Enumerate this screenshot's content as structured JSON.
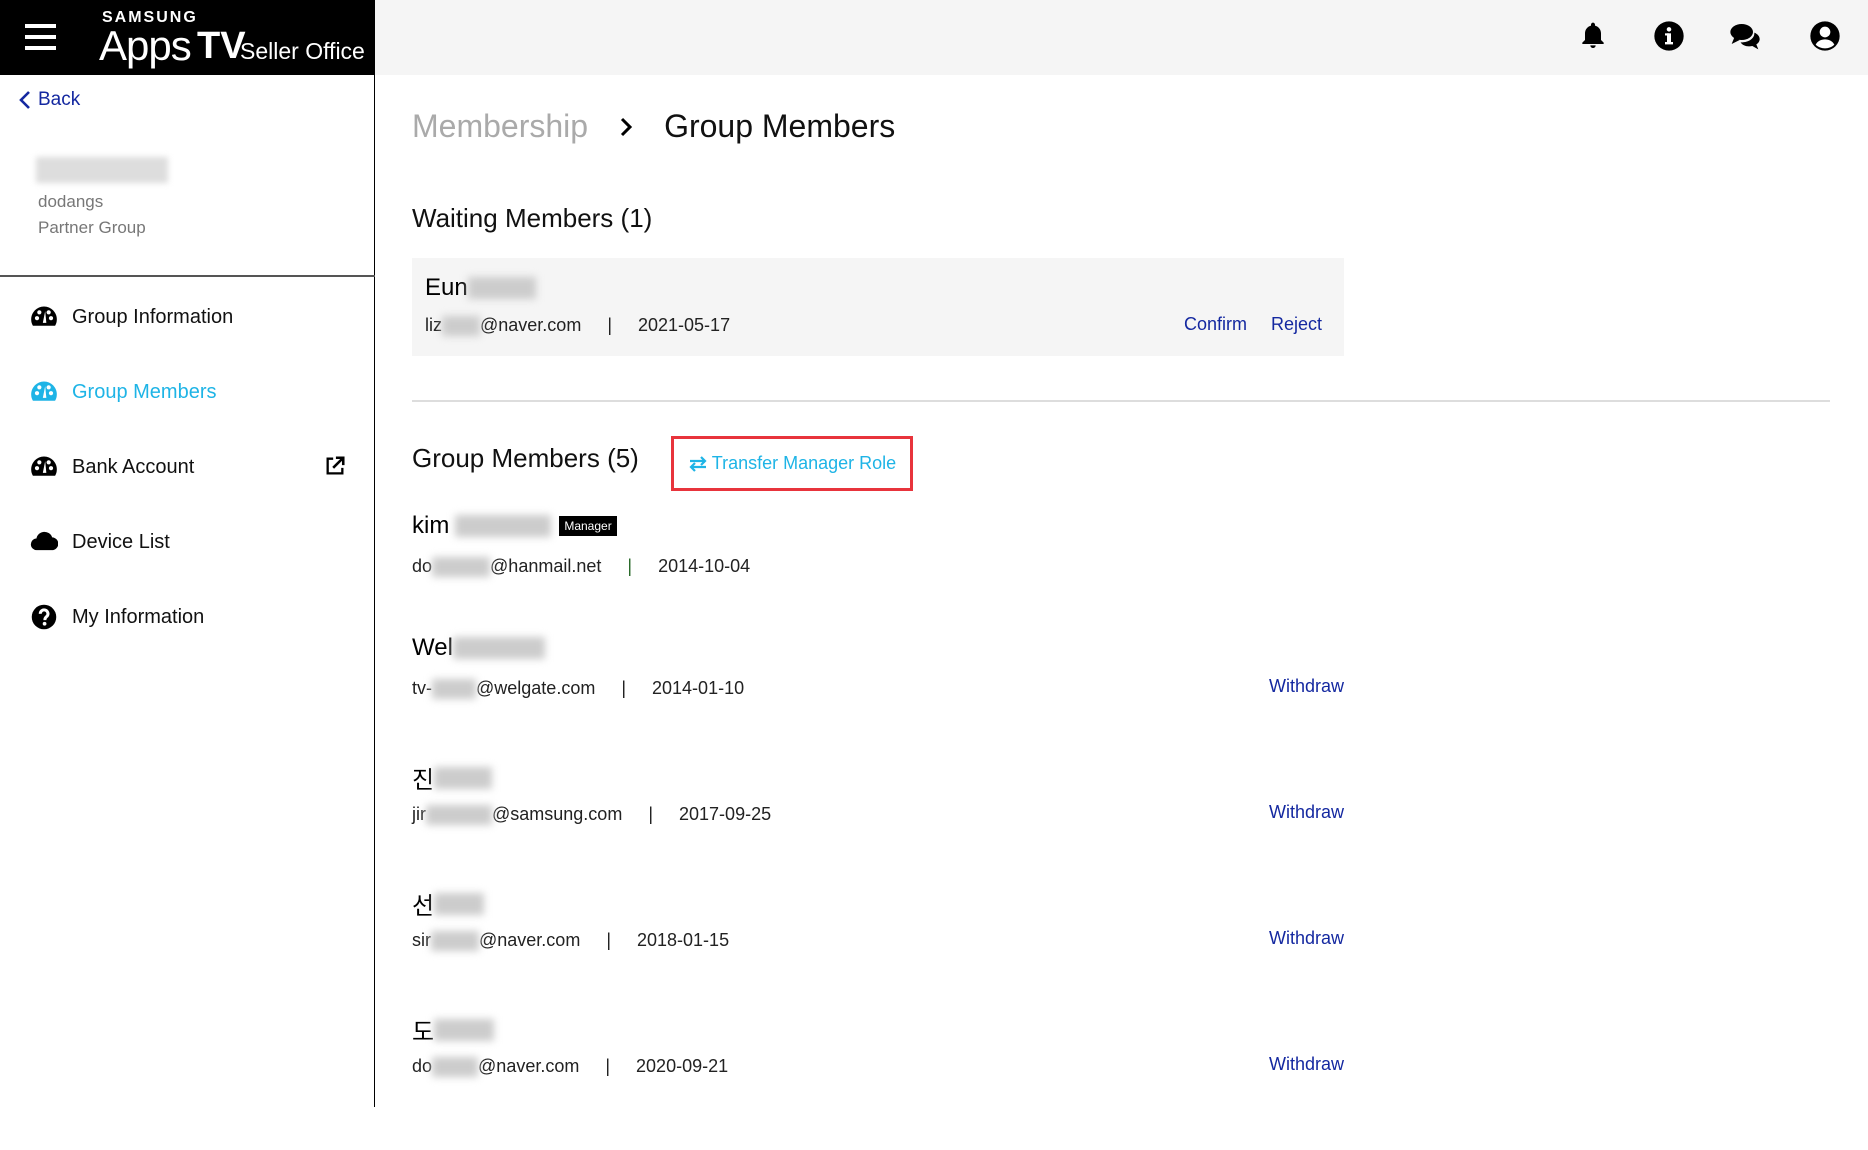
{
  "header": {
    "brand_top": "SAMSUNG",
    "brand_apps": "Apps",
    "brand_tv": "TV",
    "brand_seller": "Seller Office",
    "icons": [
      "bell-icon",
      "info-icon",
      "chat-icon",
      "user-icon"
    ]
  },
  "sidebar": {
    "back_label": "Back",
    "profile": {
      "id": "dodangs",
      "group": "Partner Group"
    },
    "items": [
      {
        "label": "Group Information",
        "icon": "dashboard-icon",
        "active": false
      },
      {
        "label": "Group Members",
        "icon": "dashboard-icon",
        "active": true
      },
      {
        "label": "Bank Account",
        "icon": "dashboard-icon",
        "active": false,
        "external": true
      },
      {
        "label": "Device List",
        "icon": "cloud-icon",
        "active": false
      },
      {
        "label": "My Information",
        "icon": "question-icon",
        "active": false
      }
    ]
  },
  "breadcrumb": {
    "parent": "Membership",
    "current": "Group Members"
  },
  "waiting": {
    "title": "Waiting Members (1)",
    "members": [
      {
        "name_prefix": "Eun",
        "email_prefix": "liz",
        "email_suffix": "@naver.com",
        "date": "2021-05-17",
        "confirm": "Confirm",
        "reject": "Reject"
      }
    ]
  },
  "group": {
    "title": "Group Members (5)",
    "transfer_label": "Transfer Manager Role",
    "manager_badge": "Manager",
    "separator": "|",
    "members": [
      {
        "name_prefix": "kim",
        "email_prefix": "do",
        "email_suffix": "@hanmail.net",
        "date": "2014-10-04",
        "manager": true,
        "action": ""
      },
      {
        "name_prefix": "Wel",
        "email_prefix": "tv-",
        "email_suffix": "@welgate.com",
        "date": "2014-01-10",
        "manager": false,
        "action": "Withdraw"
      },
      {
        "name_prefix": "진",
        "email_prefix": "jir",
        "email_suffix": "@samsung.com",
        "date": "2017-09-25",
        "manager": false,
        "action": "Withdraw"
      },
      {
        "name_prefix": "선",
        "email_prefix": "sir",
        "email_suffix": "@naver.com",
        "date": "2018-01-15",
        "manager": false,
        "action": "Withdraw"
      },
      {
        "name_prefix": "도",
        "email_prefix": "do",
        "email_suffix": "@naver.com",
        "date": "2020-09-21",
        "manager": false,
        "action": "Withdraw"
      }
    ]
  },
  "colors": {
    "accent": "#1eb4e6",
    "link": "#1428a0",
    "highlight": "#e8343c"
  }
}
